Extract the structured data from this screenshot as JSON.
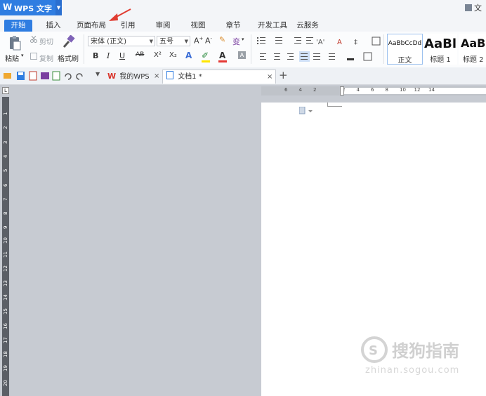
{
  "app": {
    "name": "WPS 文字",
    "logo": "W"
  },
  "title_right": "文",
  "menu_tabs": [
    "开始",
    "插入",
    "页面布局",
    "引用",
    "审阅",
    "视图",
    "章节",
    "开发工具",
    "云服务"
  ],
  "ribbon": {
    "paste": "粘贴",
    "cut": "剪切",
    "copy": "复制",
    "format_painter": "格式刷",
    "font_name": "宋体 (正文)",
    "font_size": "五号",
    "bold": "B",
    "italic": "I",
    "underline": "U",
    "strike": "AB",
    "superscript": "X²",
    "subscript": "X₂",
    "styles": [
      {
        "sample": "AaBbCcDd",
        "label": "正文"
      },
      {
        "sample": "AaBl",
        "label": "标题 1"
      },
      {
        "sample": "AaBl",
        "label": "标题 2"
      }
    ]
  },
  "doc_tabs": {
    "mywps": "我的WPS",
    "doc": "文档1 *",
    "add": "+"
  },
  "hruler_labels": [
    "6",
    "4",
    "2",
    "",
    "2",
    "4",
    "6",
    "8",
    "10",
    "12",
    "14"
  ],
  "vruler_labels": [
    "1",
    "2",
    "3",
    "4",
    "5",
    "6",
    "7",
    "8",
    "9",
    "10",
    "11",
    "12",
    "13",
    "14",
    "15",
    "16",
    "17",
    "18",
    "19",
    "20"
  ],
  "watermark": {
    "brand": "搜狗指南",
    "url": "zhinan.sogou.com"
  },
  "accent_color": "#2f7de1",
  "annotation_color": "#e03c31"
}
